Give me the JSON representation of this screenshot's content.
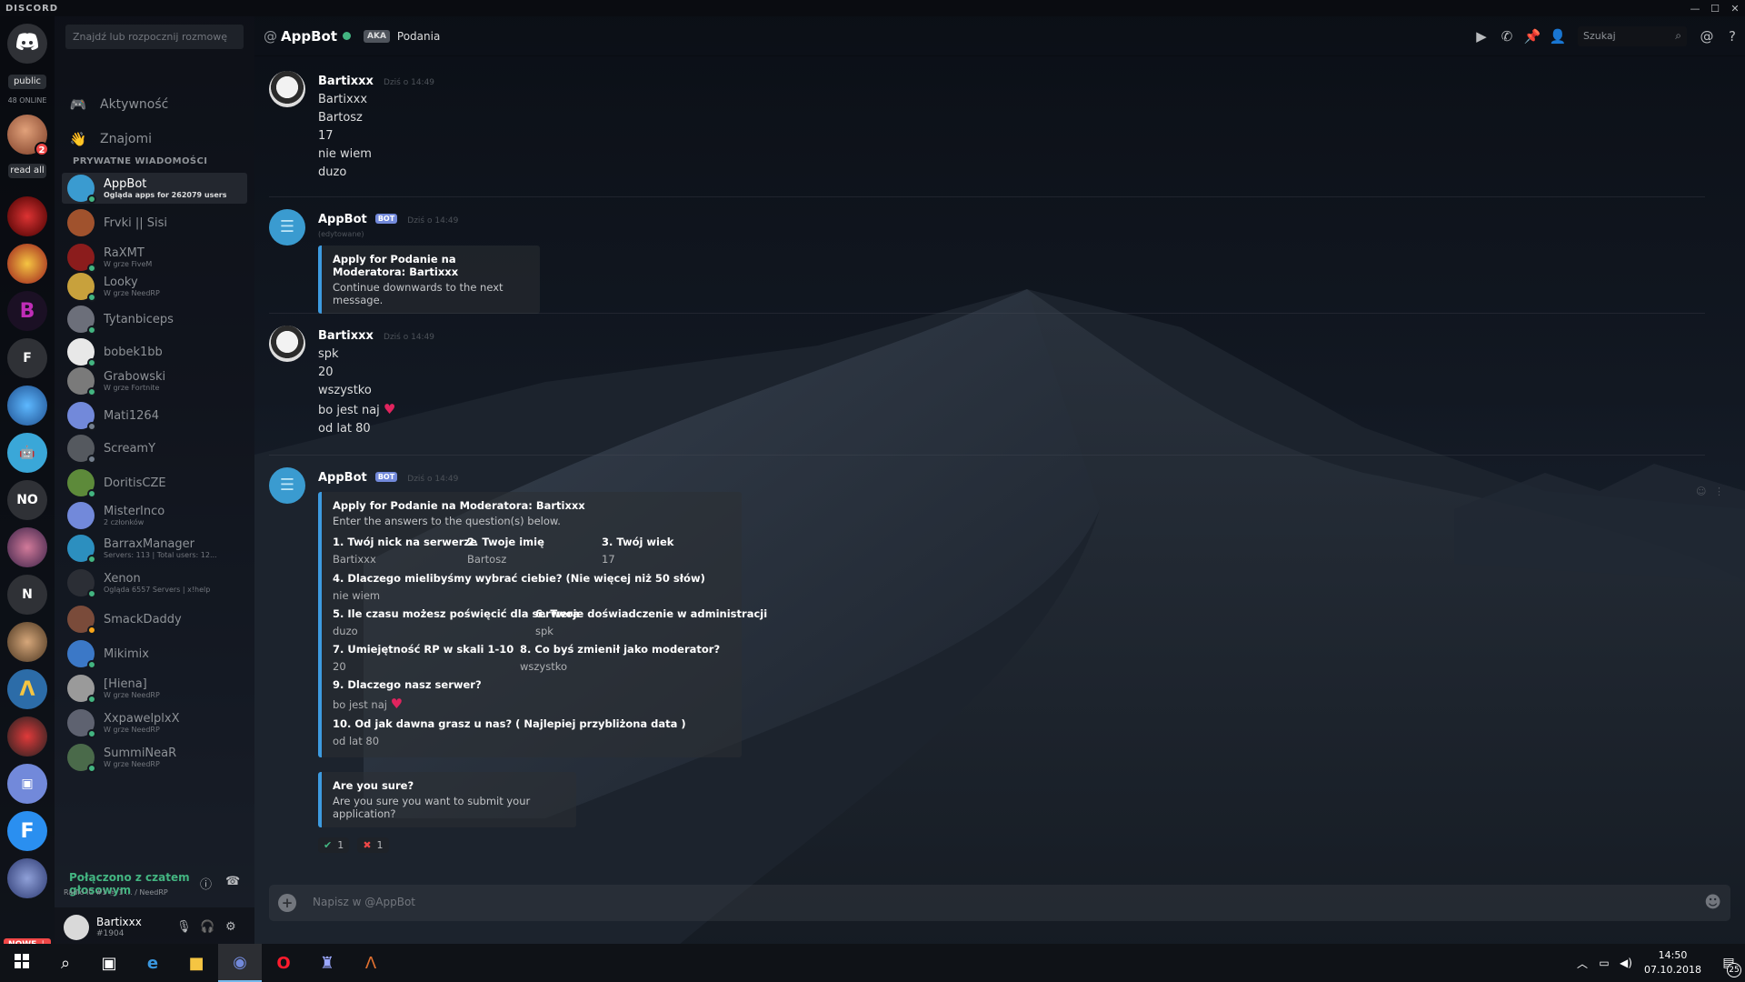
{
  "window": {
    "brand": "DISCORD",
    "controls": [
      "—",
      "☐",
      "✕"
    ]
  },
  "rail": {
    "public_label": "public",
    "online_label": "48 ONLINE",
    "read_all_label": "read all",
    "avatar_badge": "2",
    "server_letters": {
      "f": "F",
      "no": "NO",
      "n": "N",
      "fb": "F"
    },
    "nowe_label": "NOWE ⇣"
  },
  "dms": {
    "search_placeholder": "Znajdź lub rozpocznij rozmowę",
    "nav": [
      {
        "label": "Aktywność"
      },
      {
        "label": "Znajomi"
      }
    ],
    "section_header": "PRYWATNE WIADOMOŚCI",
    "items": [
      {
        "name": "AppBot",
        "sub": "Ogląda apps for 262079 users",
        "color": "#3a9bd0",
        "status": "#43b581"
      },
      {
        "name": "Frvki || Sisi",
        "sub": "",
        "color": "#a0522d",
        "status": ""
      },
      {
        "name": "RaXMT",
        "sub": "W grze FiveM",
        "color": "#8b1c1c",
        "status": "#43b581"
      },
      {
        "name": "Looky",
        "sub": "W grze NeedRP",
        "color": "#c8a13c",
        "status": "#43b581"
      },
      {
        "name": "Tytanbiceps",
        "sub": "",
        "color": "#6c6f7a",
        "status": "#43b581"
      },
      {
        "name": "bobek1bb",
        "sub": "",
        "color": "#e8e8e8",
        "status": "#43b581"
      },
      {
        "name": "Grabowski",
        "sub": "W grze Fortnite",
        "color": "#7a7a7a",
        "status": "#43b581"
      },
      {
        "name": "Mati1264",
        "sub": "",
        "color": "#7289da",
        "status": "#747f8d"
      },
      {
        "name": "ScreamY",
        "sub": "",
        "color": "#55595f",
        "status": "#747f8d"
      },
      {
        "name": "DoritisCZE",
        "sub": "",
        "color": "#5d8a3a",
        "status": "#43b581"
      },
      {
        "name": "MisterInco",
        "sub": "2 członków",
        "color": "#7289da",
        "status": ""
      },
      {
        "name": "BarraxManager",
        "sub": "Servers: 113 | Total users: 12...",
        "color": "#2c8fbf",
        "status": "#43b581"
      },
      {
        "name": "Xenon",
        "sub": "Ogląda 6557 Servers | x!help",
        "color": "#2b2e35",
        "status": "#43b581"
      },
      {
        "name": "SmackDaddy",
        "sub": "",
        "color": "#7a4b3a",
        "status": "#faa61a"
      },
      {
        "name": "Mikimix",
        "sub": "",
        "color": "#3b78c7",
        "status": "#43b581"
      },
      {
        "name": "[Hiena]",
        "sub": "W grze NeedRP",
        "color": "#9a9a9a",
        "status": "#43b581"
      },
      {
        "name": "XxpawelplxX",
        "sub": "W grze NeedRP",
        "color": "#5e6270",
        "status": "#43b581"
      },
      {
        "name": "SummiNeaR",
        "sub": "W grze NeedRP",
        "color": "#4a6a4a",
        "status": "#43b581"
      }
    ],
    "voice": {
      "title": "Połączono z czatem głosowym",
      "subtitle": "Radio IC #1 ⓑ 1 ... / NeedRP"
    },
    "user": {
      "name": "Bartixxx",
      "tag": "#1904"
    }
  },
  "header": {
    "at": "@",
    "channel": "AppBot",
    "aka_badge": "AKA",
    "aka_name": "Podania",
    "search_placeholder": "Szukaj"
  },
  "messages": [
    {
      "author": "Bartixxx",
      "timestamp": "Dziś o 14:49",
      "lines": [
        "Bartixxx",
        "Bartosz",
        "17",
        "nie wiem",
        "duzo"
      ]
    },
    {
      "author": "AppBot",
      "bot_tag": "BOT",
      "timestamp": "Dziś o 14:49",
      "edited": "(edytowane)",
      "embed_title": "Apply for Podanie na Moderatora: Bartixxx",
      "embed_desc": "Continue downwards to the next message."
    },
    {
      "author": "Bartixxx",
      "timestamp": "Dziś o 14:49",
      "lines": [
        "spk",
        "20",
        "wszystko",
        "bo jest naj",
        "od lat 80"
      ]
    },
    {
      "author": "AppBot",
      "bot_tag": "BOT",
      "timestamp": "Dziś o 14:49",
      "embed_title": "Apply for Podanie na Moderatora: Bartixxx",
      "embed_desc": "Enter the answers to the question(s) below.",
      "fields": [
        {
          "name": "1. Twój nick na serwerze",
          "value": "Bartixxx"
        },
        {
          "name": "2. Twoje imię",
          "value": "Bartosz"
        },
        {
          "name": "3. Twój wiek",
          "value": "17"
        },
        {
          "name": "4. Dlaczego mielibyśmy wybrać ciebie? (Nie więcej niż 50 słów)",
          "value": "nie wiem"
        },
        {
          "name": "5. Ile czasu możesz poświęcić dla serwera",
          "value": "duzo"
        },
        {
          "name": "6. Twoje doświadczenie w administracji",
          "value": "spk"
        },
        {
          "name": "7. Umiejętność RP w skali 1-10",
          "value": "20"
        },
        {
          "name": "8. Co byś zmienił jako moderator?",
          "value": "wszystko"
        },
        {
          "name": "9. Dlaczego nasz serwer?",
          "value": "bo jest naj"
        },
        {
          "name": "10. Od jak dawna grasz u nas? ( Najlepiej przybliżona data )",
          "value": "od lat 80"
        }
      ],
      "confirm_title": "Are you sure?",
      "confirm_desc": "Are you sure you want to submit your application?",
      "reactions": [
        {
          "emoji": "✔",
          "count": "1"
        },
        {
          "emoji": "✖",
          "count": "1"
        }
      ]
    }
  ],
  "composer": {
    "placeholder": "Napisz w @AppBot"
  },
  "taskbar": {
    "time": "14:50",
    "date": "07.10.2018",
    "notif_count": "25"
  }
}
